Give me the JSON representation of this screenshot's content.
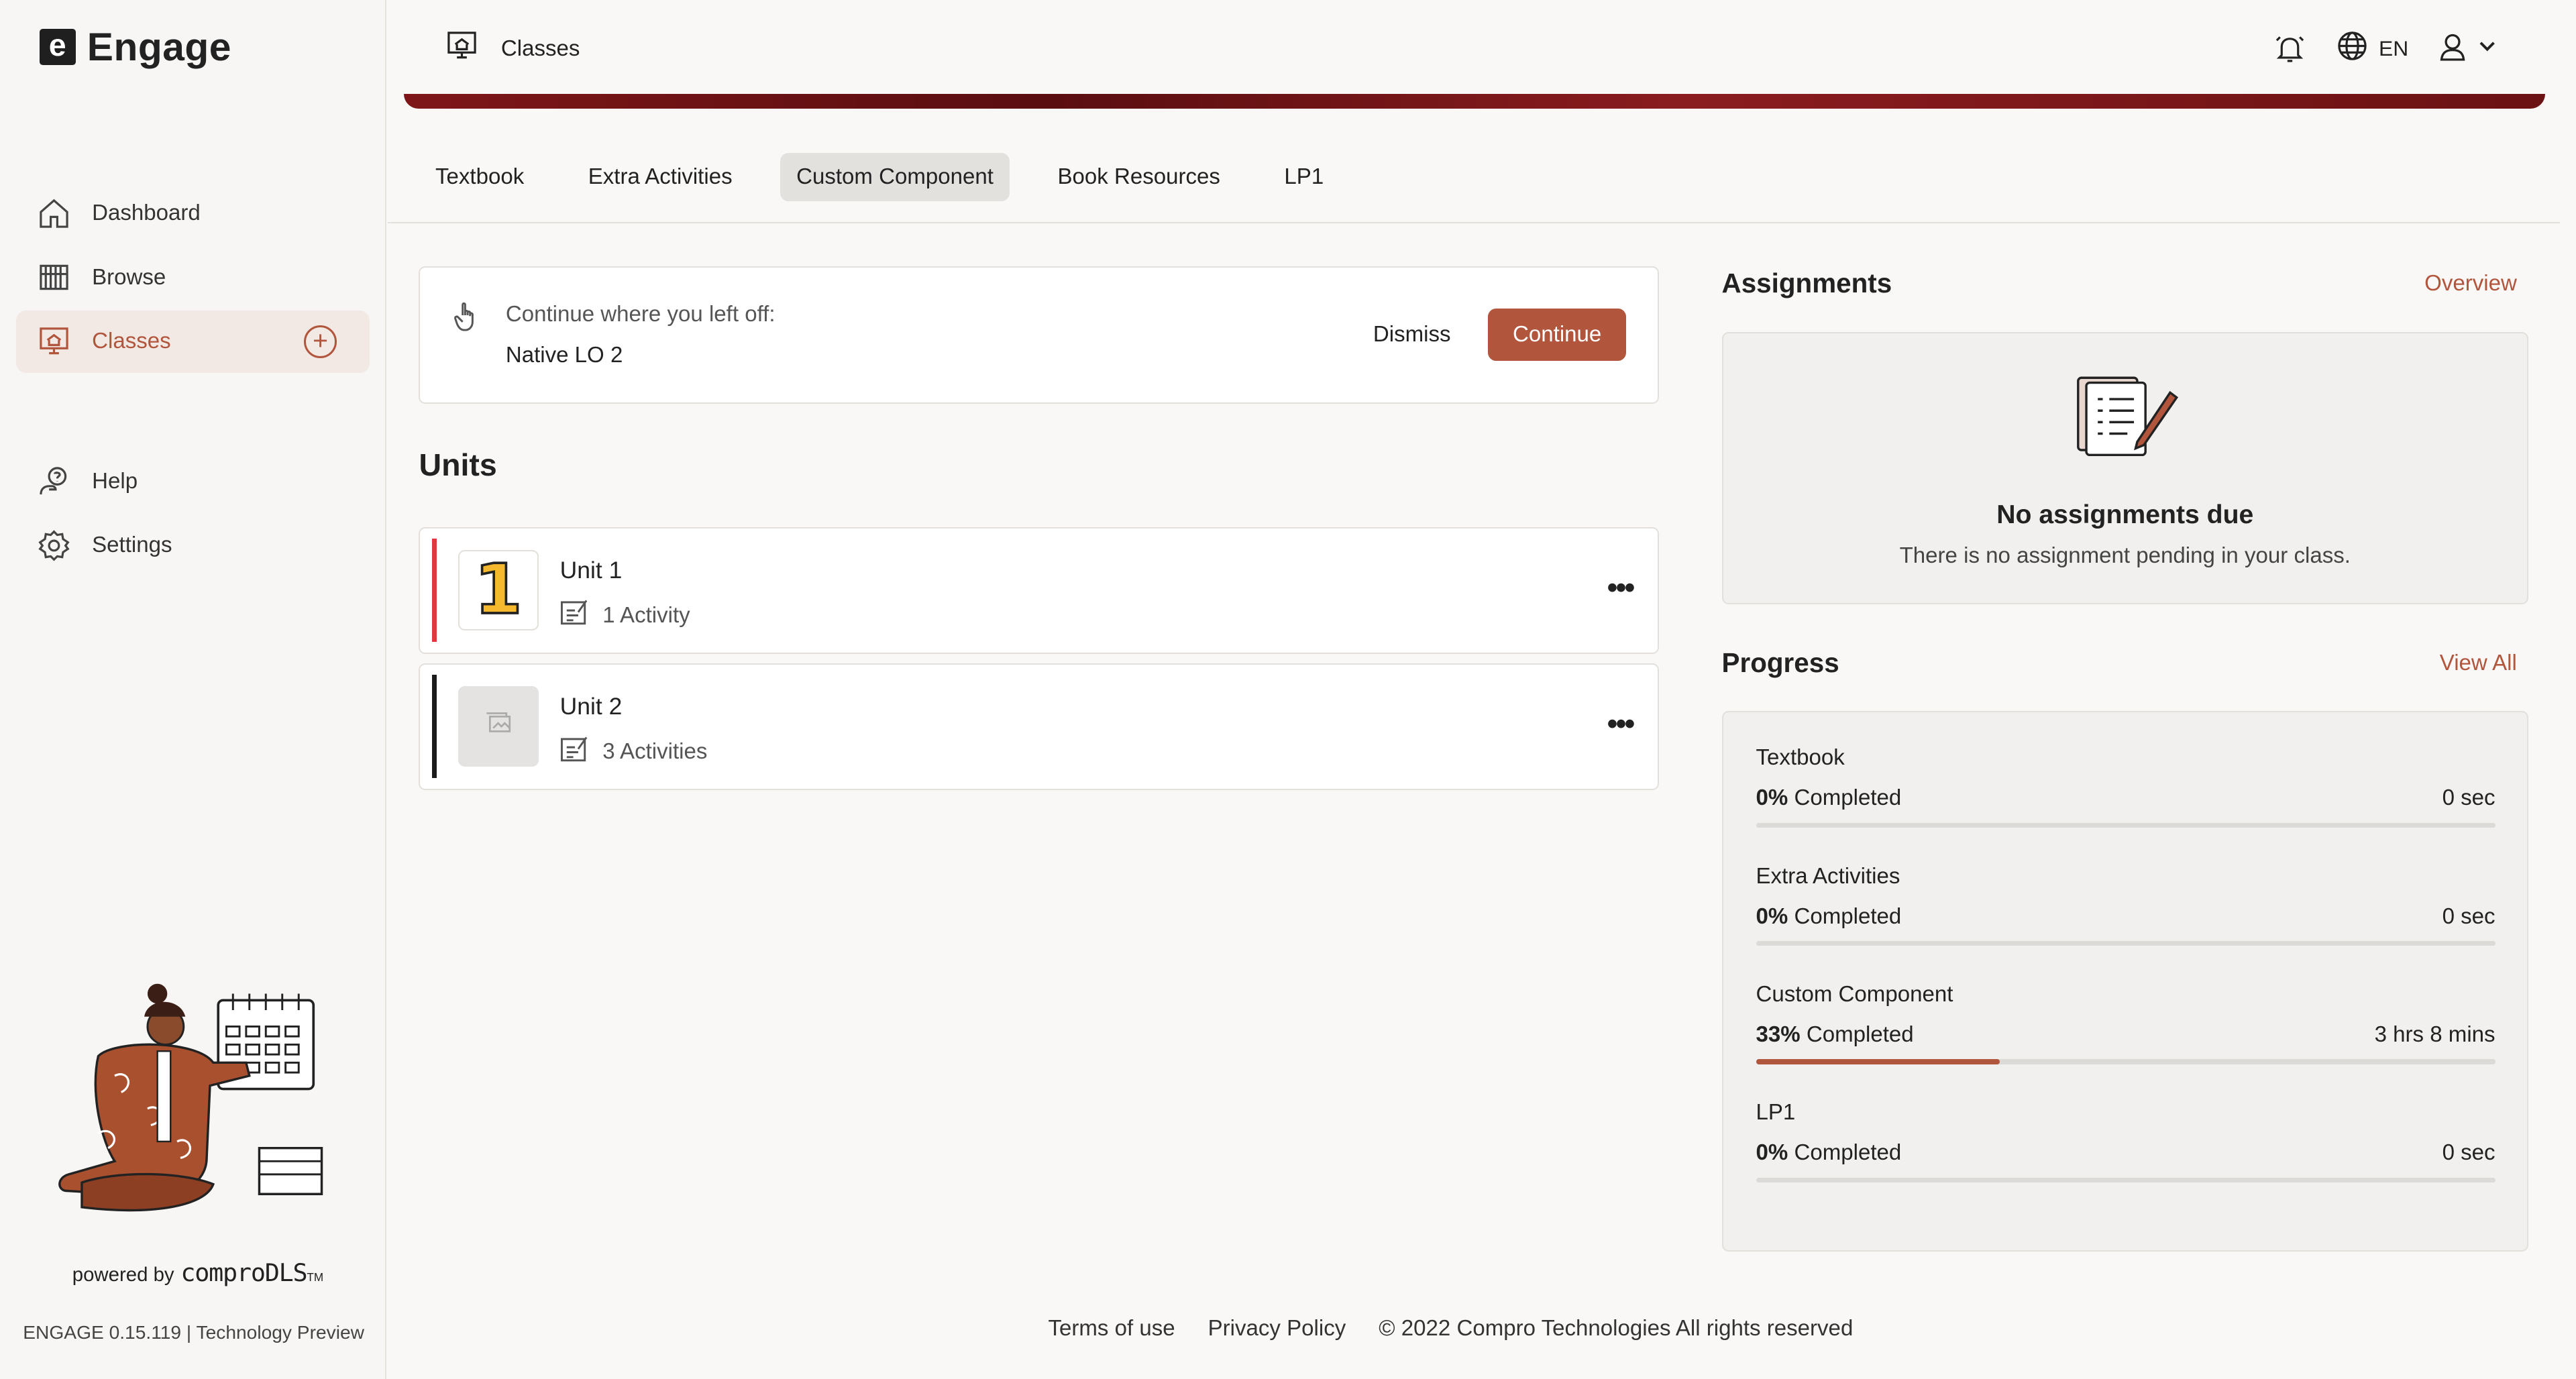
{
  "app": {
    "name": "Engage",
    "logo_letter": "e"
  },
  "sidebar": {
    "items": [
      {
        "label": "Dashboard",
        "icon": "home-icon"
      },
      {
        "label": "Browse",
        "icon": "library-icon"
      },
      {
        "label": "Classes",
        "icon": "classroom-icon",
        "active": true,
        "action_icon": "add-circle-icon"
      },
      {
        "label": "Help",
        "icon": "help-icon"
      },
      {
        "label": "Settings",
        "icon": "gear-icon"
      }
    ],
    "powered_by": "powered by",
    "powered_brand": "comproDLS",
    "trademark": "TM",
    "version": "ENGAGE 0.15.119 | Technology Preview"
  },
  "header": {
    "breadcrumb": "Classes",
    "language": "EN"
  },
  "tabs": [
    "Textbook",
    "Extra Activities",
    "Custom Component",
    "Book Resources",
    "LP1"
  ],
  "active_tab": "Custom Component",
  "continue": {
    "label": "Continue where you left off:",
    "item": "Native LO 2",
    "dismiss": "Dismiss",
    "continue": "Continue"
  },
  "units": {
    "title": "Units",
    "items": [
      {
        "title": "Unit 1",
        "activities": "1 Activity",
        "thumb_text": "1",
        "bar_color": "#e0393c"
      },
      {
        "title": "Unit 2",
        "activities": "3 Activities",
        "thumb_text": "",
        "bar_color": "#1a1a1a"
      }
    ],
    "more": "•••"
  },
  "assignments": {
    "title": "Assignments",
    "link": "Overview",
    "empty_title": "No assignments due",
    "empty_text": "There is no assignment pending in your class."
  },
  "progress": {
    "title": "Progress",
    "link": "View All",
    "items": [
      {
        "name": "Textbook",
        "percent": "0%",
        "suffix": "Completed",
        "time": "0 sec",
        "fraction": 0.0
      },
      {
        "name": "Extra Activities",
        "percent": "0%",
        "suffix": "Completed",
        "time": "0 sec",
        "fraction": 0.0
      },
      {
        "name": "Custom Component",
        "percent": "33%",
        "suffix": "Completed",
        "time": "3 hrs 8 mins",
        "fraction": 0.33
      },
      {
        "name": "LP1",
        "percent": "0%",
        "suffix": "Completed",
        "time": "0 sec",
        "fraction": 0.0
      }
    ]
  },
  "footer": {
    "terms": "Terms of use",
    "privacy": "Privacy Policy",
    "copyright": "© 2022 Compro Technologies All rights reserved"
  },
  "colors": {
    "accent": "#b1553c",
    "banner": "#7e1619"
  }
}
